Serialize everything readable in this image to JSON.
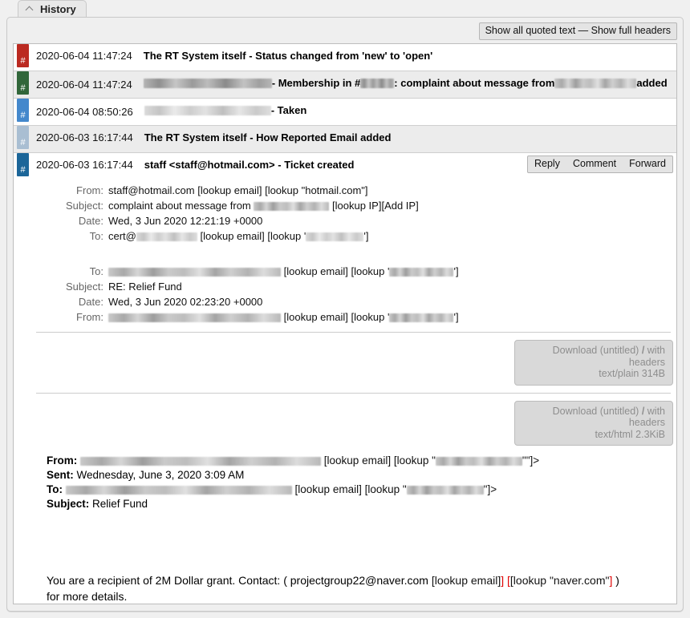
{
  "tab": {
    "label": "History",
    "collapse_icon": "chevron-up-icon"
  },
  "toolbar": {
    "show_quoted": "Show all quoted text",
    "separator": " — ",
    "show_headers": "Show full headers"
  },
  "history_rows": [
    {
      "badge": "#",
      "badge_color": "#bb2a21",
      "timestamp": "2020-06-04 11:47:24",
      "subject": "The RT System itself - Status changed from 'new' to 'open'",
      "shaded": false
    },
    {
      "badge": "#",
      "badge_color": "#31663a",
      "timestamp": "2020-06-04 11:47:24",
      "subject_pre": "",
      "subject_mid": " - Membership in #",
      "subject_mid2": ": complaint about message from ",
      "subject_post": " added",
      "shaded": true
    },
    {
      "badge": "#",
      "badge_color": "#4488cc",
      "timestamp": "2020-06-04 08:50:26",
      "subject_post": " - Taken",
      "shaded": false
    },
    {
      "badge": "#",
      "badge_color": "#a9bed2",
      "timestamp": "2020-06-03 16:17:44",
      "subject": "The RT System itself - How Reported Email added",
      "shaded": true
    }
  ],
  "ticket_row": {
    "badge": "#",
    "badge_color": "#1c6699",
    "timestamp": "2020-06-03 16:17:44",
    "subject": "staff <staff@hotmail.com> - Ticket created",
    "actions": [
      "Reply",
      "Comment",
      "Forward"
    ]
  },
  "headers_primary": [
    {
      "label": "From:",
      "value": "staff@hotmail.com",
      "links": [
        "[lookup email]",
        "[lookup \"hotmail.com\"]"
      ]
    },
    {
      "label": "Subject:",
      "value": "complaint about message from",
      "links": [
        "[lookup IP]",
        "[Add IP]"
      ]
    },
    {
      "label": "Date:",
      "value": "Wed, 3 Jun 2020 12:21:19 +0000",
      "links": []
    },
    {
      "label": "To:",
      "value": "cert@",
      "links": [
        "[lookup email]",
        "[lookup '",
        "']"
      ]
    }
  ],
  "headers_secondary": [
    {
      "label": "To:",
      "value": "",
      "links": [
        "[lookup email]",
        "[lookup '",
        "']"
      ]
    },
    {
      "label": "Subject:",
      "value": "RE: Relief Fund",
      "links": []
    },
    {
      "label": "Date:",
      "value": "Wed, 3 Jun 2020 02:23:20 +0000",
      "links": []
    },
    {
      "label": "From:",
      "value": "",
      "links": [
        "[lookup email]",
        "[lookup '",
        "']"
      ]
    }
  ],
  "attachments": [
    {
      "download_label": "Download (untitled)",
      "sep": " / ",
      "headers_label": "with headers",
      "meta": "text/plain 314B"
    },
    {
      "download_label": "Download (untitled)",
      "sep": " / ",
      "headers_label": "with headers",
      "meta": "text/html 2.3KiB"
    }
  ],
  "quoted_message": {
    "from_label": "From:",
    "from_links": [
      "[lookup email]",
      "[lookup \"",
      "\"\"]>"
    ],
    "sent_label": "Sent:",
    "sent_value": "Wednesday, June 3, 2020 3:09 AM",
    "to_label": "To:",
    "to_links": [
      "[lookup email]",
      "[lookup \"",
      "\"]>"
    ],
    "subject_label": "Subject:",
    "subject_value": "Relief Fund"
  },
  "body_text": {
    "part1": "You are a recipient of 2M Dollar grant. Contact: ( projectgroup22@naver.com ",
    "lookup_email": "[lookup email]",
    "lookup_domain_open": "[lookup",
    "lookup_domain_value": " \"naver.com\"",
    "bracket_close": "]",
    "part2": " ) for more details."
  }
}
